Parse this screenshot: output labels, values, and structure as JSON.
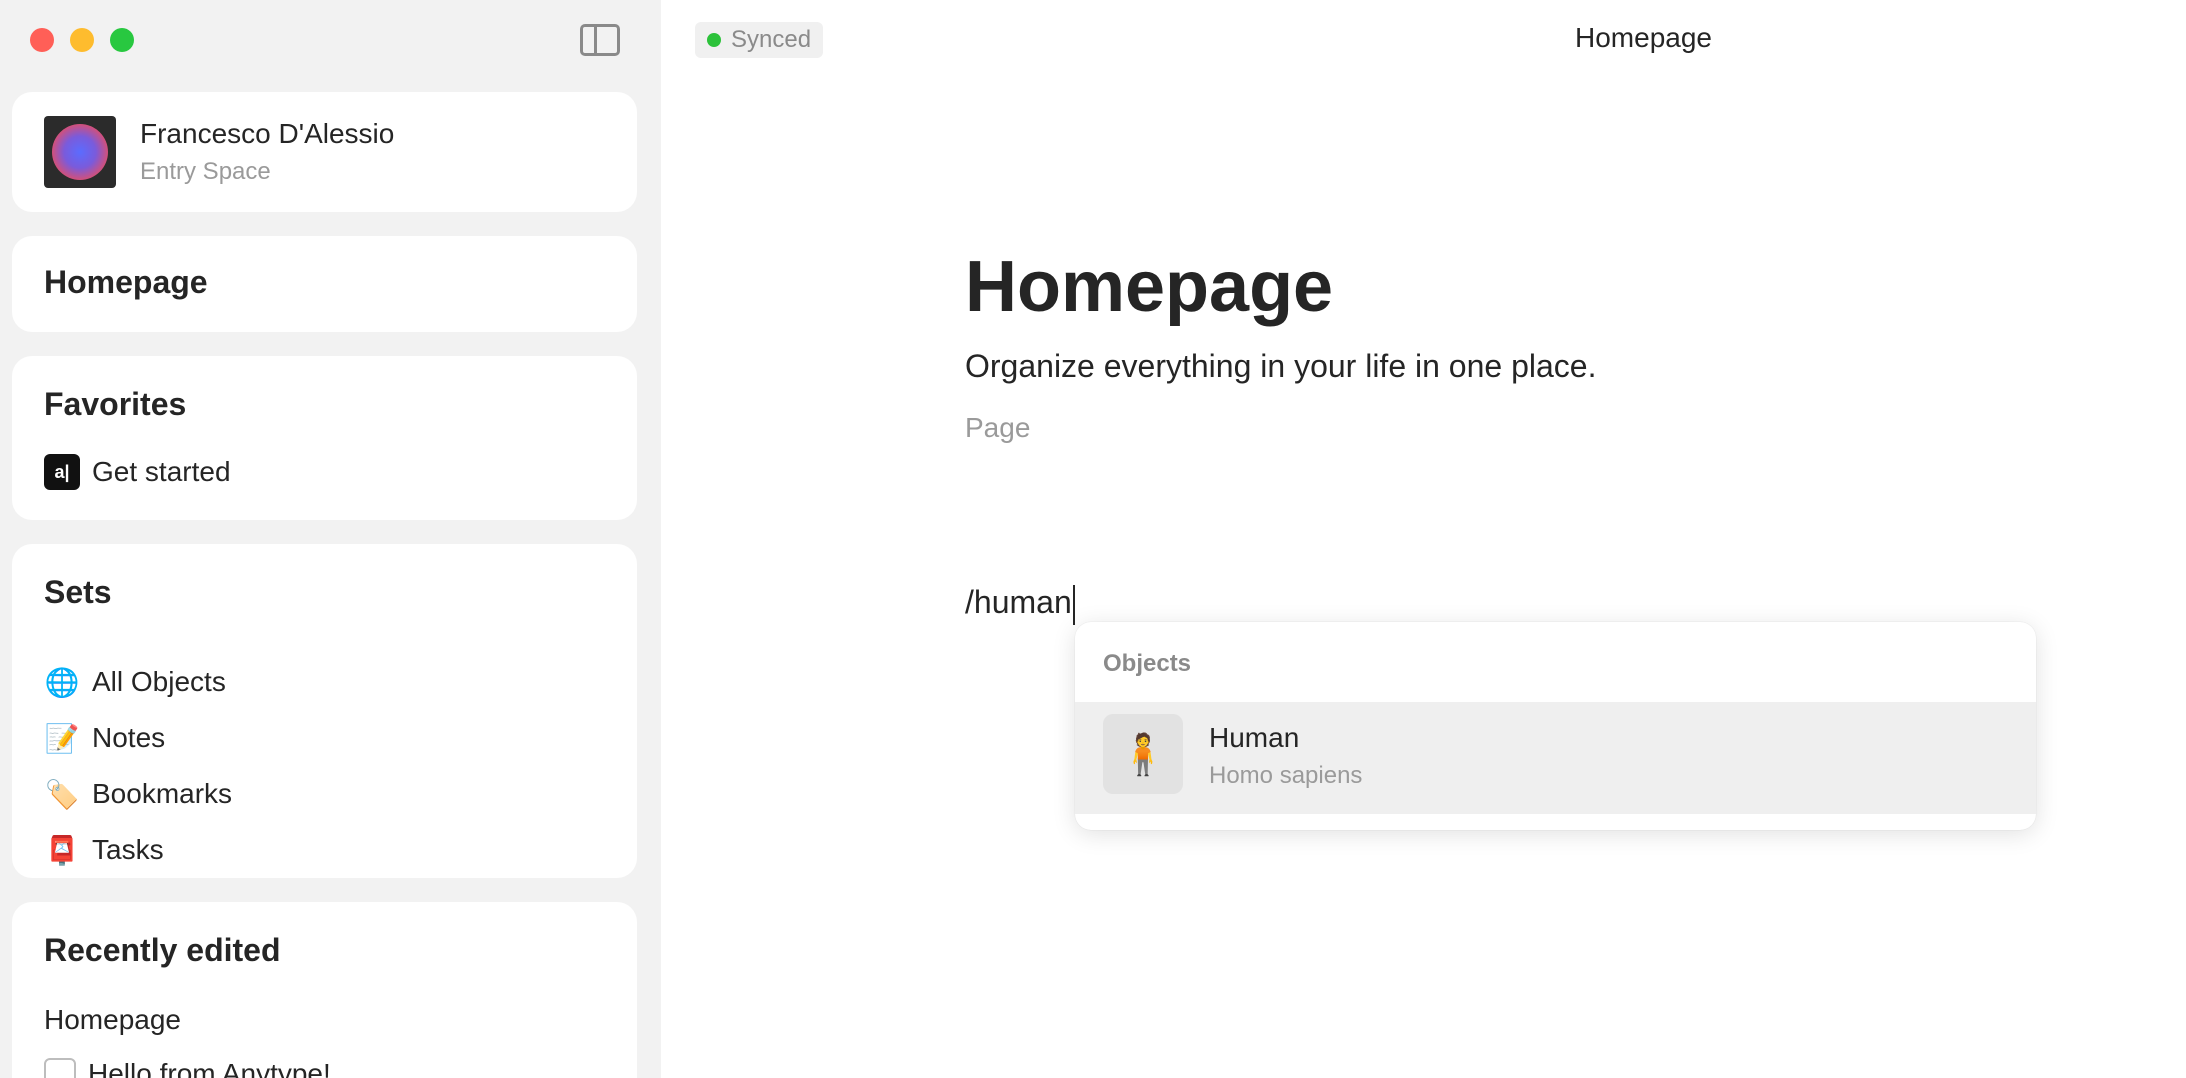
{
  "window": {
    "title": "Homepage",
    "sync_status": "Synced"
  },
  "profile": {
    "name": "Francesco D'Alessio",
    "space": "Entry Space"
  },
  "sidebar": {
    "home_label": "Homepage",
    "favorites": {
      "title": "Favorites",
      "items": [
        {
          "label": "Get started",
          "icon": "anytype-logo-icon"
        }
      ]
    },
    "sets": {
      "title": "Sets",
      "items": [
        {
          "label": "All Objects",
          "icon": "🌐"
        },
        {
          "label": "Notes",
          "icon": "📝"
        },
        {
          "label": "Bookmarks",
          "icon": "🏷️"
        },
        {
          "label": "Tasks",
          "icon": "📮"
        }
      ]
    },
    "recent": {
      "title": "Recently edited",
      "items": [
        {
          "label": "Homepage"
        },
        {
          "label": "Hello from Anytype!"
        }
      ]
    }
  },
  "page": {
    "title": "Homepage",
    "description": "Organize everything in your life in one place.",
    "type": "Page",
    "input_text": "/human"
  },
  "menu": {
    "section": "Objects",
    "items": [
      {
        "name": "Human",
        "description": "Homo sapiens",
        "icon": "🧍"
      }
    ]
  },
  "colors": {
    "sync_dot": "#2cc23a",
    "sidebar_bg": "#f2f2f2",
    "hover_bg": "#efefef"
  }
}
